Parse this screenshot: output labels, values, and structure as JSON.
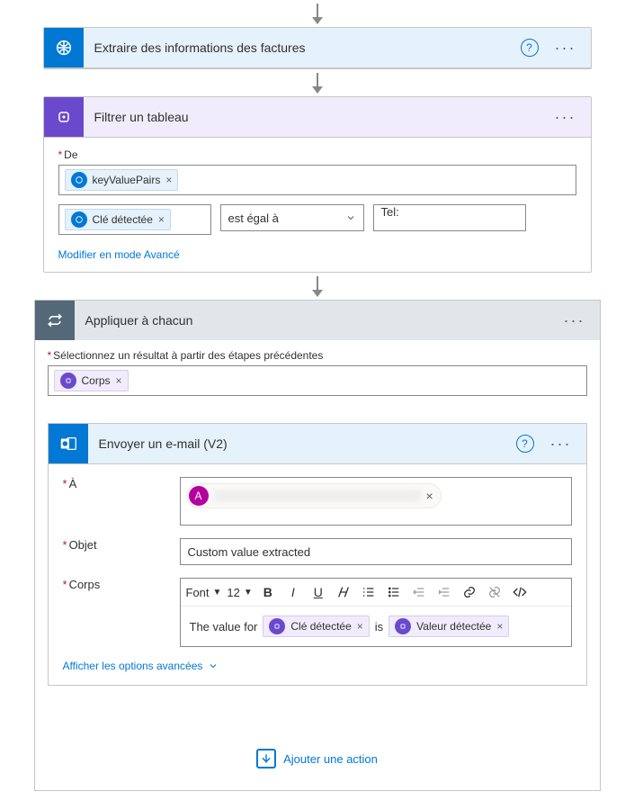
{
  "extract": {
    "title": "Extraire des informations des factures"
  },
  "filter": {
    "title": "Filtrer un tableau",
    "from_label": "De",
    "from_chip": "keyValuePairs",
    "cond_chip": "Clé détectée",
    "operator": "est égal à",
    "value": "Tel:",
    "advanced_link": "Modifier en mode Avancé"
  },
  "apply": {
    "title": "Appliquer à chacun",
    "select_label": "Sélectionnez un résultat à partir des étapes précédentes",
    "body_chip": "Corps"
  },
  "email": {
    "title": "Envoyer un e-mail (V2)",
    "to_label": "À",
    "recipient_initial": "A",
    "subject_label": "Objet",
    "subject_value": "Custom value extracted",
    "body_label": "Corps",
    "toolbar": {
      "font_label": "Font",
      "size": "12"
    },
    "body_text_1": "The value for",
    "body_chip_1": "Clé détectée",
    "body_text_2": "is",
    "body_chip_2": "Valeur détectée",
    "advanced": "Afficher les options avancées"
  },
  "add_action": "Ajouter une action"
}
